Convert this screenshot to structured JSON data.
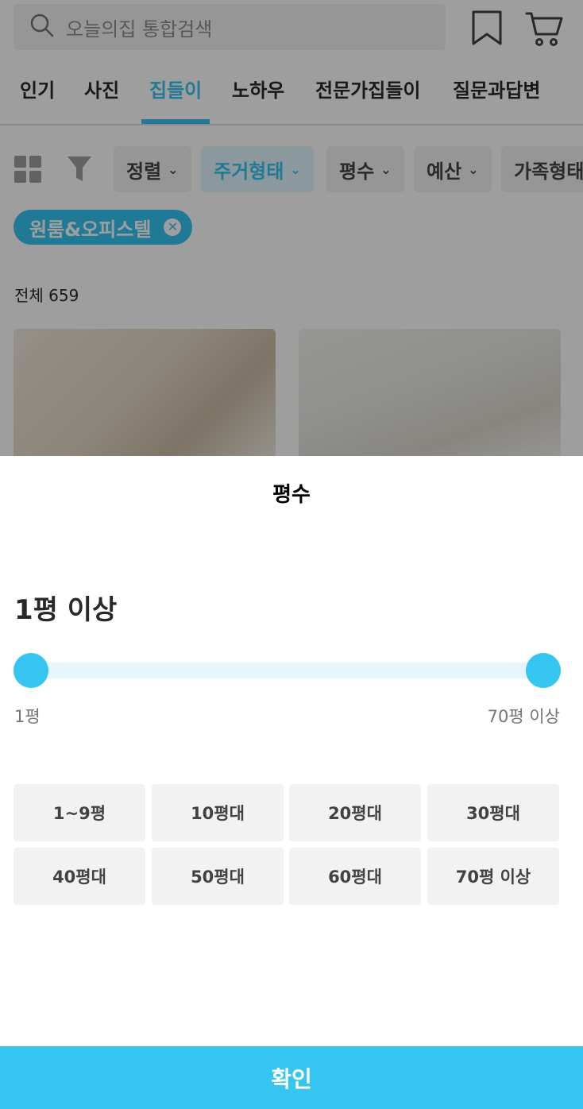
{
  "search": {
    "placeholder": "오늘의집 통합검색"
  },
  "tabs": [
    {
      "label": "인기"
    },
    {
      "label": "사진"
    },
    {
      "label": "집들이"
    },
    {
      "label": "노하우"
    },
    {
      "label": "전문가집들이"
    },
    {
      "label": "질문과답변"
    }
  ],
  "filters": {
    "chips": [
      {
        "label": "정렬"
      },
      {
        "label": "주거형태"
      },
      {
        "label": "평수"
      },
      {
        "label": "예산"
      },
      {
        "label": "가족형태"
      }
    ],
    "active_tag": "원룸&오피스텔"
  },
  "results": {
    "total": "전체 659"
  },
  "sheet": {
    "title": "평수",
    "range_label": "1평 이상",
    "slider_min": 0.0,
    "slider_max": 1.0,
    "slider_min_label": "1평",
    "slider_max_label": "70평 이상",
    "options": [
      "1~9평",
      "10평대",
      "20평대",
      "30평대",
      "40평대",
      "50평대",
      "60평대",
      "70평 이상"
    ],
    "confirm_label": "확인"
  },
  "colors": {
    "accent": "#35c5f0",
    "track": "#e6f4fb"
  }
}
